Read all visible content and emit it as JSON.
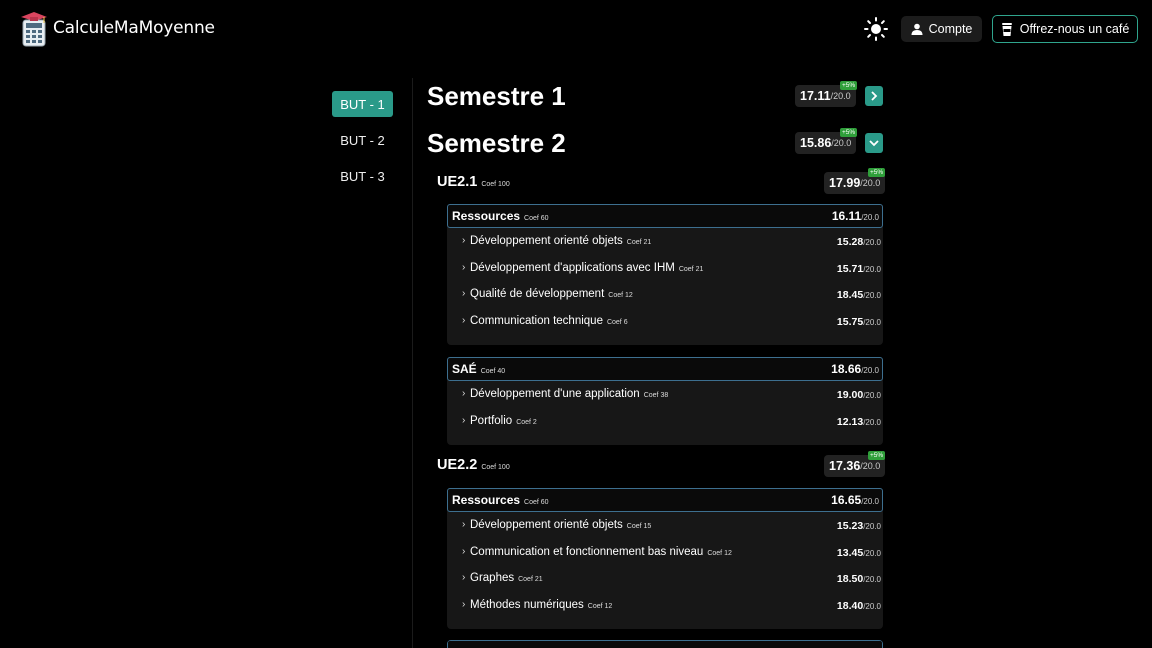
{
  "app": {
    "title": "CalculeMaMoyenne"
  },
  "header": {
    "account_label": "Compte",
    "coffee_label": "Offrez-nous un café"
  },
  "years": [
    {
      "label": "BUT - 1",
      "active": true
    },
    {
      "label": "BUT - 2",
      "active": false
    },
    {
      "label": "BUT - 3",
      "active": false
    }
  ],
  "max_label": "/20.0",
  "bonus_label": "+5%",
  "semesters": [
    {
      "title": "Semestre 1",
      "grade": "17.11",
      "expanded": false
    },
    {
      "title": "Semestre 2",
      "grade": "15.86",
      "expanded": true
    }
  ],
  "ues": [
    {
      "name": "UE2.1",
      "coef": "Coef 100",
      "grade": "17.99",
      "groups": [
        {
          "name": "Ressources",
          "coef": "Coef 60",
          "grade": "16.11",
          "items": [
            {
              "name": "Développement orienté objets",
              "coef": "Coef 21",
              "grade": "15.28"
            },
            {
              "name": "Développement d'applications avec IHM",
              "coef": "Coef 21",
              "grade": "15.71"
            },
            {
              "name": "Qualité de développement",
              "coef": "Coef 12",
              "grade": "18.45"
            },
            {
              "name": "Communication technique",
              "coef": "Coef 6",
              "grade": "15.75"
            }
          ]
        },
        {
          "name": "SAÉ",
          "coef": "Coef 40",
          "grade": "18.66",
          "items": [
            {
              "name": "Développement d'une application",
              "coef": "Coef 38",
              "grade": "19.00"
            },
            {
              "name": "Portfolio",
              "coef": "Coef 2",
              "grade": "12.13"
            }
          ]
        }
      ]
    },
    {
      "name": "UE2.2",
      "coef": "Coef 100",
      "grade": "17.36",
      "groups": [
        {
          "name": "Ressources",
          "coef": "Coef 60",
          "grade": "16.65",
          "items": [
            {
              "name": "Développement orienté objets",
              "coef": "Coef 15",
              "grade": "15.23"
            },
            {
              "name": "Communication et fonctionnement bas niveau",
              "coef": "Coef 12",
              "grade": "13.45"
            },
            {
              "name": "Graphes",
              "coef": "Coef 21",
              "grade": "18.50"
            },
            {
              "name": "Méthodes numériques",
              "coef": "Coef 12",
              "grade": "18.40"
            }
          ]
        }
      ]
    }
  ],
  "colors": {
    "accent": "#2a9a89",
    "bonus": "#2f9f3a",
    "group_border": "#3d6f8f"
  }
}
